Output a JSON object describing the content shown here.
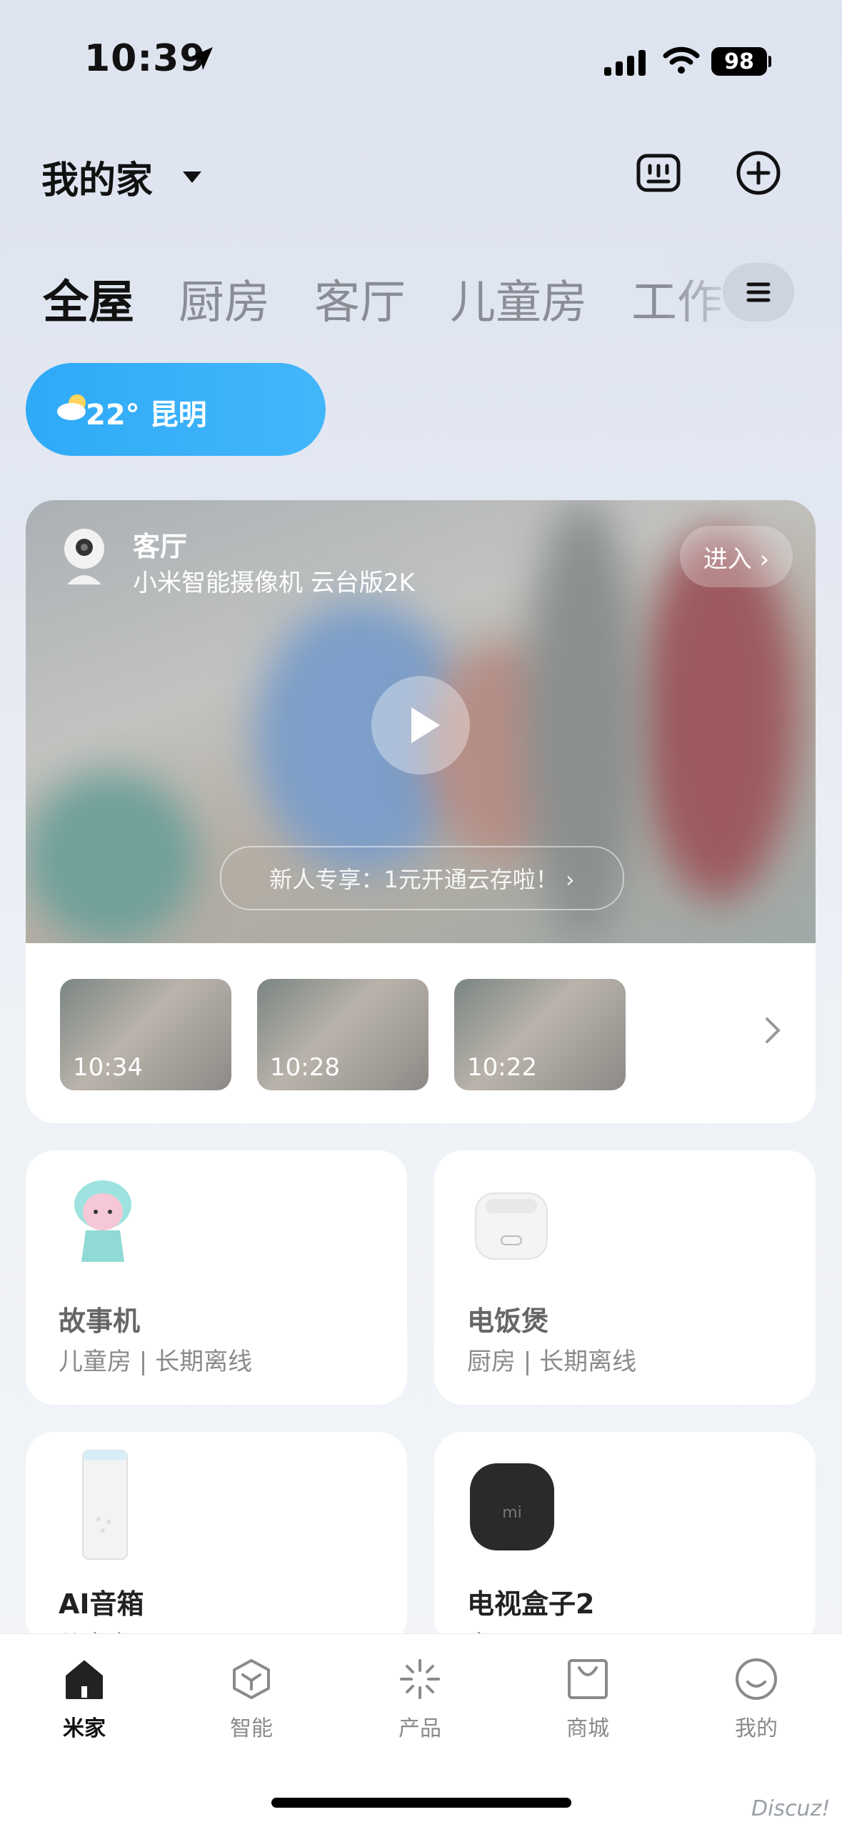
{
  "status_bar": {
    "time": "10:39",
    "battery": "98"
  },
  "header": {
    "home_name": "我的家"
  },
  "tabs": [
    {
      "label": "全屋"
    },
    {
      "label": "厨房"
    },
    {
      "label": "客厅"
    },
    {
      "label": "儿童房"
    },
    {
      "label": "工作"
    }
  ],
  "weather": {
    "text": "22° 昆明"
  },
  "camera": {
    "room": "客厅",
    "device": "小米智能摄像机 云台版2K",
    "enter_label": "进入 ›",
    "promo": "新人专享：1元开通云存啦！ ›",
    "clips": [
      {
        "time": "10:34"
      },
      {
        "time": "10:28"
      },
      {
        "time": "10:22"
      }
    ]
  },
  "devices": [
    {
      "name": "故事机",
      "status": "儿童房 | 长期离线"
    },
    {
      "name": "电饭煲",
      "status": "厨房 | 长期离线"
    },
    {
      "name": "AI音箱",
      "status": "儿童房"
    },
    {
      "name": "电视盒子2",
      "status": "客厅"
    }
  ],
  "nav": [
    {
      "label": "米家",
      "icon": "home-icon"
    },
    {
      "label": "智能",
      "icon": "cube-icon"
    },
    {
      "label": "产品",
      "icon": "sparkle-icon"
    },
    {
      "label": "商城",
      "icon": "bag-icon"
    },
    {
      "label": "我的",
      "icon": "smile-icon"
    }
  ],
  "watermark": "Discuz!",
  "colors": {
    "accent": "#2faaf7",
    "background": "#e3e8f2"
  }
}
